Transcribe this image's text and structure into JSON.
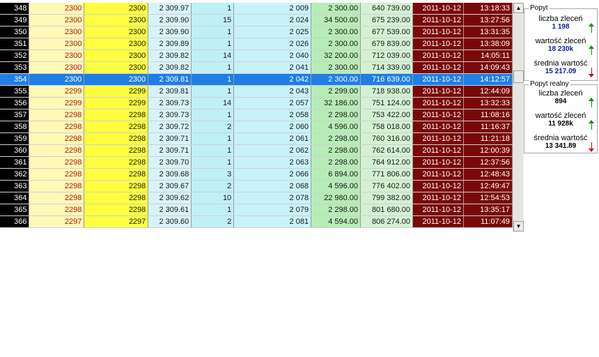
{
  "grid": {
    "rows": [
      {
        "id": "348",
        "p1": "2300",
        "p2": "2300",
        "avg": "2 309.97",
        "qty": "1",
        "cum": "2 009",
        "val": "2 300.00",
        "sum": "640 739.00",
        "date": "2011-10-12",
        "time": "13:18:33"
      },
      {
        "id": "349",
        "p1": "2300",
        "p2": "2300",
        "avg": "2 309.90",
        "qty": "15",
        "cum": "2 024",
        "val": "34 500.00",
        "sum": "675 239.00",
        "date": "2011-10-12",
        "time": "13:27:56"
      },
      {
        "id": "350",
        "p1": "2300",
        "p2": "2300",
        "avg": "2 309.90",
        "qty": "1",
        "cum": "2 025",
        "val": "2 300.00",
        "sum": "677 539.00",
        "date": "2011-10-12",
        "time": "13:31:35"
      },
      {
        "id": "351",
        "p1": "2300",
        "p2": "2300",
        "avg": "2 309.89",
        "qty": "1",
        "cum": "2 026",
        "val": "2 300.00",
        "sum": "679 839.00",
        "date": "2011-10-12",
        "time": "13:38:09"
      },
      {
        "id": "352",
        "p1": "2300",
        "p2": "2300",
        "avg": "2 309.82",
        "qty": "14",
        "cum": "2 040",
        "val": "32 200.00",
        "sum": "712 039.00",
        "date": "2011-10-12",
        "time": "14:05:11"
      },
      {
        "id": "353",
        "p1": "2300",
        "p2": "2300",
        "avg": "2 309.82",
        "qty": "1",
        "cum": "2 041",
        "val": "2 300.00",
        "sum": "714 339.00",
        "date": "2011-10-12",
        "time": "14:09:43"
      },
      {
        "id": "354",
        "p1": "2300",
        "p2": "2300",
        "avg": "2 309.81",
        "qty": "1",
        "cum": "2 042",
        "val": "2 300.00",
        "sum": "716 639.00",
        "date": "2011-10-12",
        "time": "14:12:57",
        "selected": true
      },
      {
        "id": "355",
        "p1": "2299",
        "p2": "2299",
        "avg": "2 309.81",
        "qty": "1",
        "cum": "2 043",
        "val": "2 299.00",
        "sum": "718 938.00",
        "date": "2011-10-12",
        "time": "12:44:09"
      },
      {
        "id": "356",
        "p1": "2299",
        "p2": "2299",
        "avg": "2 309.73",
        "qty": "14",
        "cum": "2 057",
        "val": "32 186.00",
        "sum": "751 124.00",
        "date": "2011-10-12",
        "time": "13:32:33"
      },
      {
        "id": "357",
        "p1": "2298",
        "p2": "2298",
        "avg": "2 309.73",
        "qty": "1",
        "cum": "2 058",
        "val": "2 298.00",
        "sum": "753 422.00",
        "date": "2011-10-12",
        "time": "11:08:16"
      },
      {
        "id": "358",
        "p1": "2298",
        "p2": "2298",
        "avg": "2 309.72",
        "qty": "2",
        "cum": "2 060",
        "val": "4 596.00",
        "sum": "758 018.00",
        "date": "2011-10-12",
        "time": "11:16:37"
      },
      {
        "id": "359",
        "p1": "2298",
        "p2": "2298",
        "avg": "2 309.71",
        "qty": "1",
        "cum": "2 061",
        "val": "2 298.00",
        "sum": "760 316.00",
        "date": "2011-10-12",
        "time": "11:21:18"
      },
      {
        "id": "360",
        "p1": "2298",
        "p2": "2298",
        "avg": "2 309.71",
        "qty": "1",
        "cum": "2 062",
        "val": "2 298.00",
        "sum": "762 614.00",
        "date": "2011-10-12",
        "time": "12:00:39"
      },
      {
        "id": "361",
        "p1": "2298",
        "p2": "2298",
        "avg": "2 309.70",
        "qty": "1",
        "cum": "2 063",
        "val": "2 298.00",
        "sum": "764 912.00",
        "date": "2011-10-12",
        "time": "12:37:56"
      },
      {
        "id": "362",
        "p1": "2298",
        "p2": "2298",
        "avg": "2 309.68",
        "qty": "3",
        "cum": "2 066",
        "val": "6 894.00",
        "sum": "771 806.00",
        "date": "2011-10-12",
        "time": "12:48:43"
      },
      {
        "id": "363",
        "p1": "2298",
        "p2": "2298",
        "avg": "2 309.67",
        "qty": "2",
        "cum": "2 068",
        "val": "4 596.00",
        "sum": "776 402.00",
        "date": "2011-10-12",
        "time": "12:49:47"
      },
      {
        "id": "364",
        "p1": "2298",
        "p2": "2298",
        "avg": "2 309.62",
        "qty": "10",
        "cum": "2 078",
        "val": "22 980.00",
        "sum": "799 382.00",
        "date": "2011-10-12",
        "time": "12:54:53"
      },
      {
        "id": "365",
        "p1": "2298",
        "p2": "2298",
        "avg": "2 309.61",
        "qty": "1",
        "cum": "2 079",
        "val": "2 298.00",
        "sum": "801 680.00",
        "date": "2011-10-12",
        "time": "13:35:17"
      },
      {
        "id": "366",
        "p1": "2297",
        "p2": "2297",
        "avg": "2 309.60",
        "qty": "2",
        "cum": "2 081",
        "val": "4 594.00",
        "sum": "806 274.00",
        "date": "2011-10-12",
        "time": "11:07:49"
      }
    ]
  },
  "scrollbar": {
    "up_glyph": "▲",
    "down_glyph": "▼"
  },
  "panels": {
    "popyt": {
      "title": "Popyt",
      "stats": [
        {
          "label": "liczba zleceń",
          "value": "1 198",
          "trend": "up",
          "icon": "arrow-up-icon"
        },
        {
          "label": "wartość zleceń",
          "value": "18 230k",
          "trend": "up",
          "icon": "arrow-up-icon"
        },
        {
          "label": "średnia wartość",
          "value": "15 217.09",
          "trend": "down",
          "icon": "arrow-down-icon"
        }
      ]
    },
    "popyt_realny": {
      "title": "Popyt realny",
      "stats": [
        {
          "label": "liczba zleceń",
          "value": "894",
          "trend": "up",
          "icon": "arrow-up-icon"
        },
        {
          "label": "wartość zleceń",
          "value": "11 928k",
          "trend": "up",
          "icon": "arrow-up-icon"
        },
        {
          "label": "średnia wartość",
          "value": "13 341.89",
          "trend": "down",
          "icon": "arrow-down-icon"
        }
      ]
    }
  },
  "colors": {
    "selection": "#1f7fe6",
    "id_bg": "#000000",
    "price_text": "#b31500",
    "price2_bg": "#ffff40",
    "date_bg": "#7a0808",
    "trend_up": "#0b8f0b",
    "trend_down": "#d00000",
    "panel_value_blue": "#0a1aa0"
  }
}
